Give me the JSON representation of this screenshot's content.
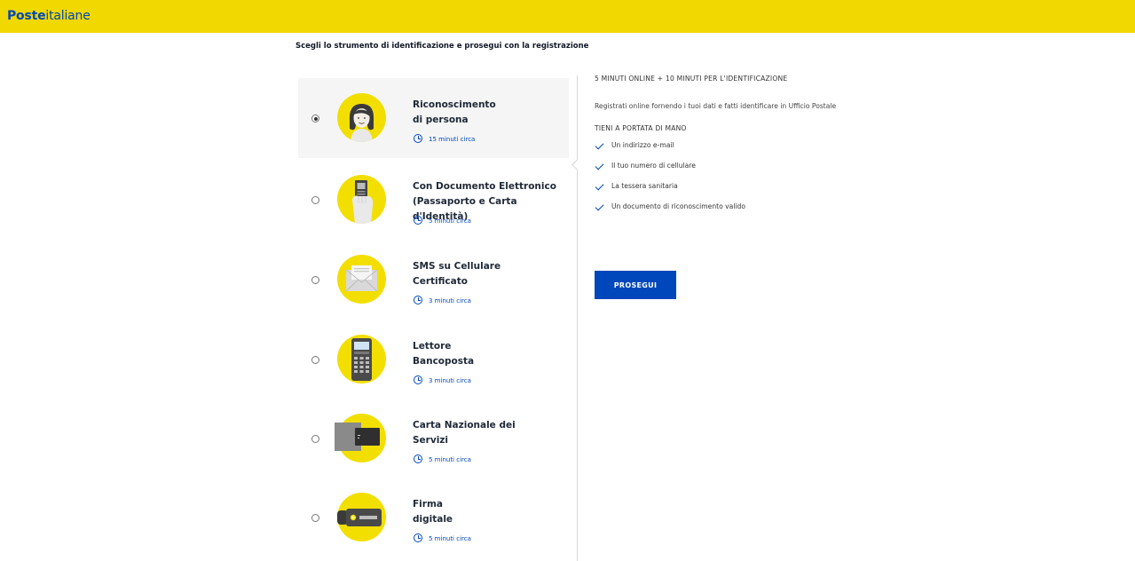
{
  "header": {
    "logo_bold": "Poste",
    "logo_light": "italiane"
  },
  "page": {
    "title": "Scegli lo strumento di identificazione e prosegui con la registrazione"
  },
  "options": [
    {
      "title_line1": "Riconoscimento",
      "title_line2": "di persona",
      "time": "15 minuti circa",
      "selected": true,
      "icon": "woman-face-icon"
    },
    {
      "title_line1": "Con Documento Elettronico",
      "title_line2": "(Passaporto e Carta d'Identità)",
      "time": "5 minuti circa",
      "selected": false,
      "icon": "hand-card-icon"
    },
    {
      "title_line1": "SMS su Cellulare",
      "title_line2": "Certificato",
      "time": "3 minuti circa",
      "selected": false,
      "icon": "envelope-icon"
    },
    {
      "title_line1": "Lettore",
      "title_line2": "Bancoposta",
      "time": "3 minuti circa",
      "selected": false,
      "icon": "card-reader-icon"
    },
    {
      "title_line1": "Carta Nazionale dei",
      "title_line2": "Servizi",
      "time": "5 minuti circa",
      "selected": false,
      "icon": "smart-card-icon"
    },
    {
      "title_line1": "Firma",
      "title_line2": "digitale",
      "time": "5 minuti circa",
      "selected": false,
      "icon": "usb-key-icon"
    }
  ],
  "detail": {
    "headline": "5 MINUTI ONLINE + 10 MINUTI PER L'IDENTIFICAZIONE",
    "description": "Registrati online fornendo i tuoi dati e fatti identificare in Ufficio Postale",
    "subhead": "TIENI A PORTATA DI MANO",
    "items": [
      "Un indirizzo e-mail",
      "Il tuo numero di cellulare",
      "La tessera sanitaria",
      "Un documento di riconoscimento valido"
    ],
    "button": "PROSEGUI"
  },
  "colors": {
    "brand_yellow": "#f0d800",
    "brand_blue": "#0047bb",
    "selected_bg": "#f5f5f5"
  }
}
